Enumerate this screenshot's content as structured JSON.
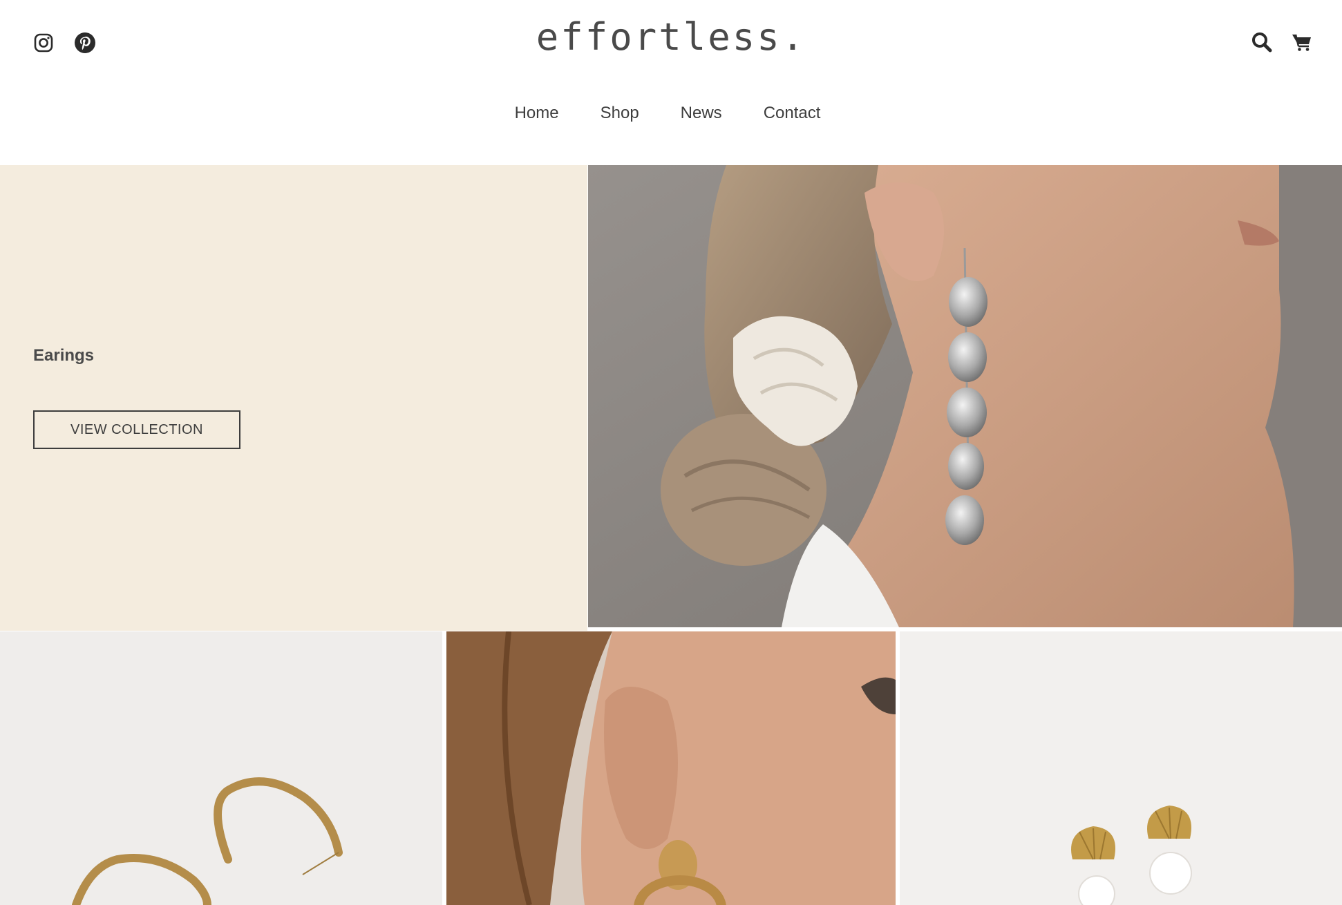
{
  "header": {
    "logo": "effortless.",
    "social_icons": [
      "instagram-icon",
      "pinterest-icon"
    ],
    "utility_icons": [
      "search-icon",
      "cart-icon"
    ]
  },
  "nav": {
    "items": [
      "Home",
      "Shop",
      "News",
      "Contact"
    ]
  },
  "hero": {
    "title": "Earings",
    "button_label": "VIEW COLLECTION",
    "image_alt": "Woman wearing long silver disc earring"
  },
  "products": [
    {
      "image_alt": "Gold hoop earrings"
    },
    {
      "image_alt": "Woman wearing gold drop earring"
    },
    {
      "image_alt": "Gold shell pearl earrings"
    }
  ],
  "colors": {
    "hero_panel": "#f4ecde",
    "text": "#3d3d3d"
  }
}
